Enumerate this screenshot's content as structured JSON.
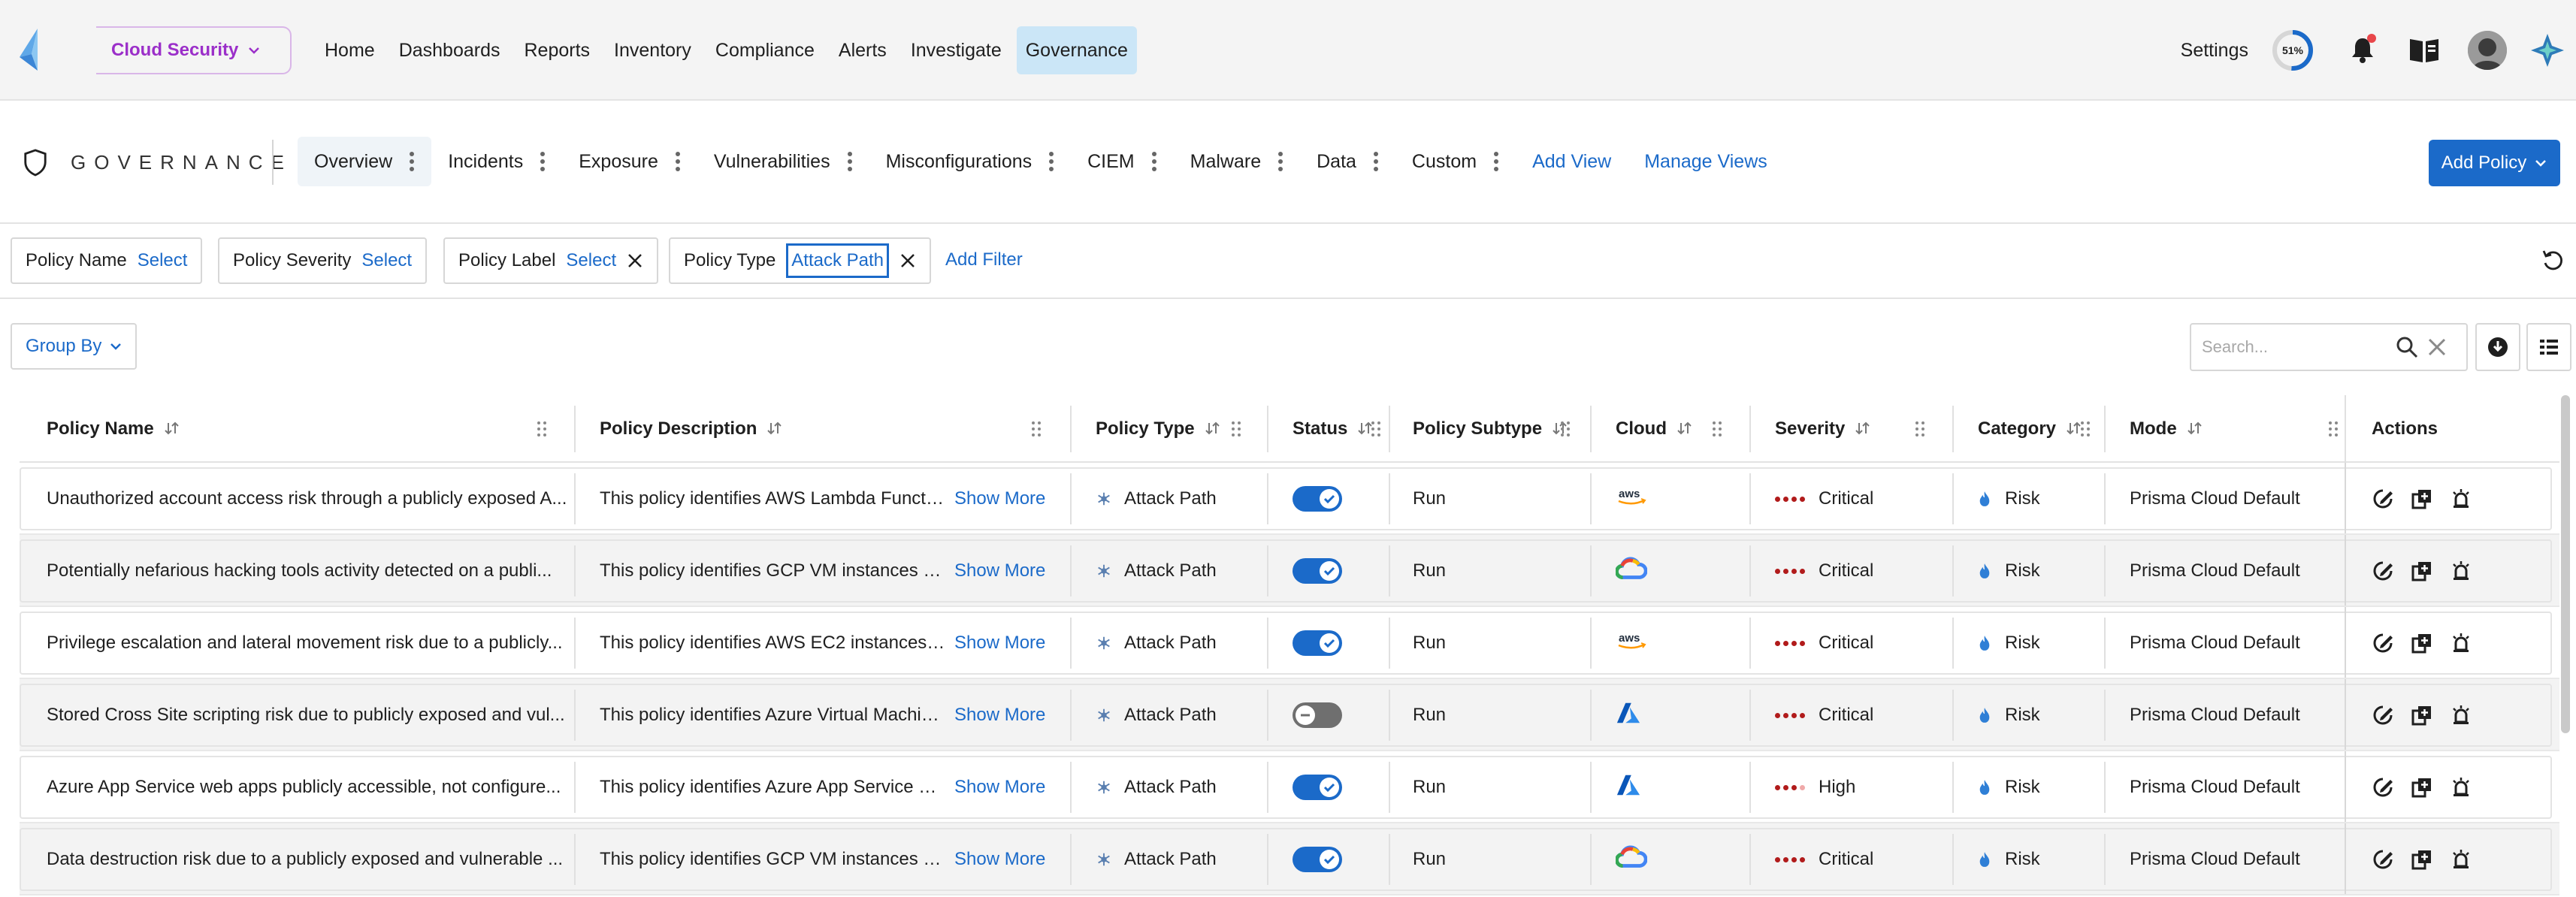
{
  "topbar": {
    "app_switcher": "Cloud Security",
    "nav": [
      "Home",
      "Dashboards",
      "Reports",
      "Inventory",
      "Compliance",
      "Alerts",
      "Investigate",
      "Governance"
    ],
    "active_nav": "Governance",
    "settings": "Settings",
    "progress": {
      "label": "51%",
      "value": 0.51
    }
  },
  "section": {
    "title": "GOVERNANCE",
    "tabs": [
      "Overview",
      "Incidents",
      "Exposure",
      "Vulnerabilities",
      "Misconfigurations",
      "CIEM",
      "Malware",
      "Data",
      "Custom"
    ],
    "active_tab": "Overview",
    "add_view": "Add View",
    "manage_views": "Manage Views",
    "add_policy": "Add Policy"
  },
  "filters": {
    "chips": [
      {
        "label": "Policy Name",
        "value": "Select"
      },
      {
        "label": "Policy Severity",
        "value": "Select"
      },
      {
        "label": "Policy Label",
        "value": "Select"
      },
      {
        "label": "Policy Type",
        "value": "Attack Path"
      }
    ],
    "add_filter": "Add Filter"
  },
  "toolbar": {
    "group_by": "Group By",
    "search_placeholder": "Search..."
  },
  "table": {
    "columns": [
      "Policy Name",
      "Policy Description",
      "Policy Type",
      "Status",
      "Policy Subtype",
      "Cloud",
      "Severity",
      "Category",
      "Mode",
      "Actions"
    ],
    "show_more": "Show More",
    "rows": [
      {
        "name": "Unauthorized account access risk through a publicly exposed A...",
        "description": "This policy identifies AWS Lambda Functio...",
        "type": "Attack Path",
        "status": "on",
        "subtype": "Run",
        "cloud": "aws",
        "severity": "Critical",
        "severity_level": 4,
        "category": "Risk",
        "mode": "Prisma Cloud Default"
      },
      {
        "name": "Potentially nefarious hacking tools activity detected on a publi...",
        "description": "This policy identifies GCP VM instances th...",
        "type": "Attack Path",
        "status": "on",
        "subtype": "Run",
        "cloud": "gcp",
        "severity": "Critical",
        "severity_level": 4,
        "category": "Risk",
        "mode": "Prisma Cloud Default"
      },
      {
        "name": "Privilege escalation and lateral movement risk due to a publicly...",
        "description": "This policy identifies AWS EC2 instances t...",
        "type": "Attack Path",
        "status": "on",
        "subtype": "Run",
        "cloud": "aws",
        "severity": "Critical",
        "severity_level": 4,
        "category": "Risk",
        "mode": "Prisma Cloud Default"
      },
      {
        "name": "Stored Cross Site scripting risk due to publicly exposed and vul...",
        "description": "This policy identifies Azure Virtual Machin...",
        "type": "Attack Path",
        "status": "off",
        "subtype": "Run",
        "cloud": "azure",
        "severity": "Critical",
        "severity_level": 4,
        "category": "Risk",
        "mode": "Prisma Cloud Default"
      },
      {
        "name": "Azure App Service web apps publicly accessible, not configure...",
        "description": "This policy identifies Azure App Service w...",
        "type": "Attack Path",
        "status": "on",
        "subtype": "Run",
        "cloud": "azure",
        "severity": "High",
        "severity_level": 3,
        "category": "Risk",
        "mode": "Prisma Cloud Default"
      },
      {
        "name": "Data destruction risk due to a publicly exposed and vulnerable ...",
        "description": "This policy identifies GCP VM instances w...",
        "type": "Attack Path",
        "status": "on",
        "subtype": "Run",
        "cloud": "gcp",
        "severity": "Critical",
        "severity_level": 4,
        "category": "Risk",
        "mode": "Prisma Cloud Default"
      }
    ]
  },
  "colors": {
    "accent": "#1b6ac9",
    "brand_purple": "#9b2fc9",
    "critical": "#b11b1b"
  }
}
